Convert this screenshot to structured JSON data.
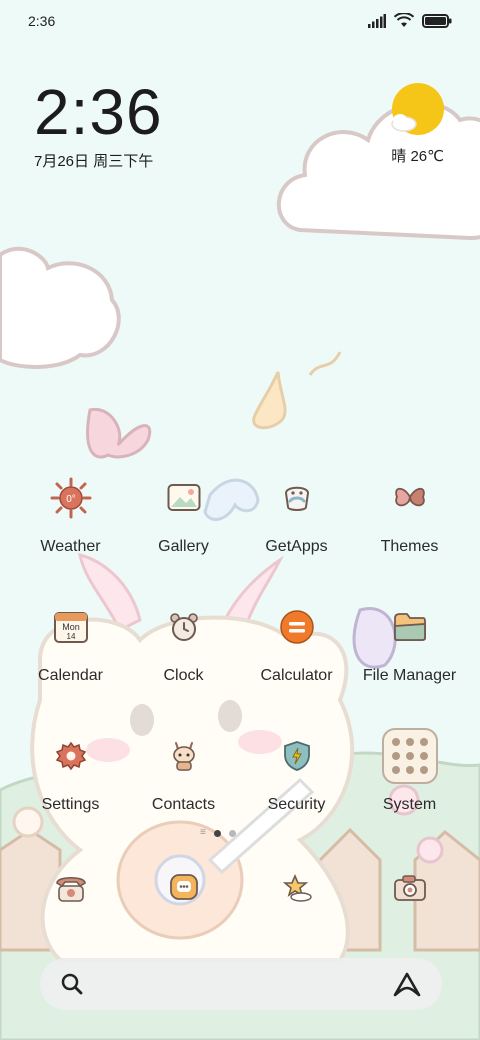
{
  "status_bar": {
    "time": "2:36"
  },
  "clock_widget": {
    "time": "2:36",
    "date": "7月26日 周三下午"
  },
  "weather_widget": {
    "text": "晴 26℃"
  },
  "apps": [
    {
      "label": "Weather",
      "icon": "sun-icon"
    },
    {
      "label": "Gallery",
      "icon": "landscape-picture-icon"
    },
    {
      "label": "GetApps",
      "icon": "bag-icon"
    },
    {
      "label": "Themes",
      "icon": "butterfly-icon"
    },
    {
      "label": "Calendar",
      "icon": "calendar-icon",
      "icon_text": "Mon\n14"
    },
    {
      "label": "Clock",
      "icon": "alarm-clock-icon"
    },
    {
      "label": "Calculator",
      "icon": "equals-icon"
    },
    {
      "label": "File Manager",
      "icon": "folder-icon"
    },
    {
      "label": "Settings",
      "icon": "gear-icon"
    },
    {
      "label": "Contacts",
      "icon": "deer-character-icon"
    },
    {
      "label": "Security",
      "icon": "shield-icon"
    },
    {
      "label": "System",
      "icon": "folder-grid-icon"
    }
  ],
  "calendar_icon": {
    "day": "Mon",
    "date": "14"
  },
  "weather_icon_text": "0°",
  "dock": [
    {
      "icon": "telephone-icon"
    },
    {
      "icon": "message-bubble-icon"
    },
    {
      "icon": "star-browser-icon"
    },
    {
      "icon": "camera-icon"
    }
  ],
  "page_indicator": {
    "pages": 2,
    "current": 1
  },
  "search_bar": {
    "left_icon": "search-icon",
    "right_icon": "assistant-icon"
  },
  "colors": {
    "background": "#eefaf8",
    "sun": "#f5c518",
    "accent_orange": "#f07a2a"
  }
}
